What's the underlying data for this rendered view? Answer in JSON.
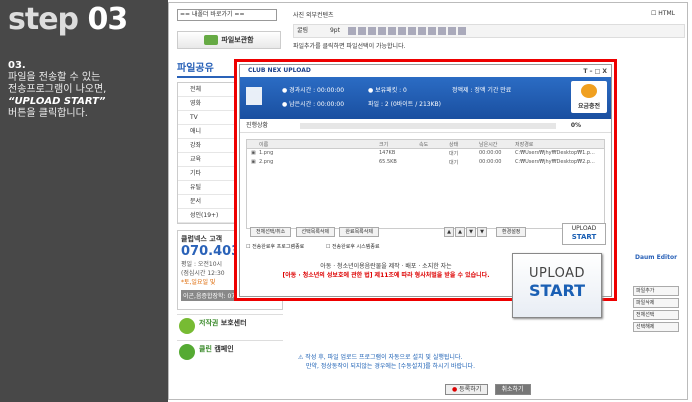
{
  "step": {
    "word": "step",
    "num": "03"
  },
  "desc": {
    "num": "03.",
    "line1": "파일을 전송할 수 있는",
    "line2": "전송프로그램이 나오면,",
    "line3": "“UPLOAD START”",
    "line4": "버튼을 클릭합니다."
  },
  "sidebar": {
    "quick": "== 내폴더 바로가기 ==",
    "save_btn": "파일보관함",
    "cat_title": "파일공유",
    "cats": [
      "전체",
      "영화",
      "TV",
      "애니",
      "강좌",
      "교육",
      "기타",
      "유틸",
      "문서",
      "성인(19+)"
    ],
    "club": {
      "title": "클럽넥스 고객",
      "phone": "070.403",
      "l1": "평일 : 오전10시",
      "l2": "(점심시간 12:30",
      "l3": "*토,일요일 및",
      "ad": "이곤,음증합장학: 070.4035.0532"
    },
    "c1": {
      "t1": "저작권",
      "t2": "보호센터"
    },
    "c2": {
      "t1": "클린",
      "t2": "캠페인"
    }
  },
  "editor": {
    "tb1": "사진  외부컨텐츠",
    "html": "HTML",
    "font": "굴림",
    "size": "9pt",
    "text": "파일추가를 클릭하면 파일선택이 가능합니다.",
    "daum": "Daum Editor",
    "side_btns": [
      "파일추가",
      "파일삭제",
      "전체선택",
      "선택해제"
    ],
    "note1": "작성 후, 파일 업로드 프로그램이 자동으로 설치 및 실행됩니다.",
    "note2": "만약, 정상동작이 되지않는 경우에는 [수동설치]를 하시기 바랍니다.",
    "register": "등록하기",
    "cancel": "취소하기"
  },
  "modal": {
    "title": "CLUB NEX UPLOAD",
    "win": "T – □ X",
    "time_left": "● 경과시간 : 00:00:00",
    "time_rem": "● 남은시간 : 00:00:00",
    "speed": "● 보유패킷 : 0",
    "file": "파일 : 2 (0바이트 / 213KB)",
    "period": "정액제 : 정액 기간 만료",
    "charge": "요금충전",
    "progress_label": "진행상황",
    "progress_pct": "0%",
    "cols": [
      "이름",
      "크기",
      "속도",
      "상태",
      "남은시간",
      "저장경로"
    ],
    "files": [
      {
        "name": "1.png",
        "size": "147KB",
        "state": "대기",
        "time": "00:00:00",
        "path": "C:₩Users₩jhy₩Desktop₩1.p..."
      },
      {
        "name": "2.png",
        "size": "65.5KB",
        "state": "대기",
        "time": "00:00:00",
        "path": "C:₩Users₩jhy₩Desktop₩2.p..."
      }
    ],
    "btns": [
      "전체선택/취소",
      "선택목록삭제",
      "완료목록삭제"
    ],
    "arrows": [
      "▲",
      "▲",
      "▼",
      "▼"
    ],
    "env": "환경설정",
    "check1": "전송완료후 프로그램종료",
    "check2": "전송완료후 시스템종료",
    "banner1": "아동 · 청소년이용음란물을 제작 · 배포 · 소지한 자는",
    "banner2": "[아동 · 청소년의 성보호에 관한 법] 제11조에 따라 형사처벌을 받을 수 있습니다.",
    "up_small_1": "UPLOAD",
    "up_small_2": "START"
  },
  "bigup": {
    "u": "UPLOAD",
    "s": "START"
  }
}
